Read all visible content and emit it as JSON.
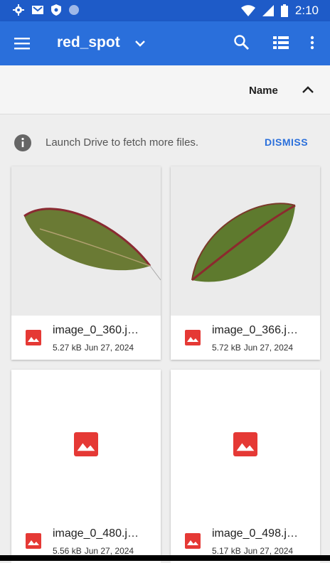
{
  "status_bar": {
    "time": "2:10"
  },
  "app_bar": {
    "title": "red_spot"
  },
  "sort_bar": {
    "label": "Name"
  },
  "notice": {
    "text": "Launch Drive to fetch more files.",
    "action": "DISMISS"
  },
  "files": [
    {
      "name": "image_0_360.j…",
      "size": "5.27 kB",
      "date": "Jun 27, 2024"
    },
    {
      "name": "image_0_366.j…",
      "size": "5.72 kB",
      "date": "Jun 27, 2024"
    },
    {
      "name": "image_0_480.j…",
      "size": "5.56 kB",
      "date": "Jun 27, 2024"
    },
    {
      "name": "image_0_498.j…",
      "size": "5.17 kB",
      "date": "Jun 27, 2024"
    }
  ],
  "colors": {
    "primary": "#2a6fdb",
    "status": "#1e5bc8",
    "image_icon": "#e53935"
  }
}
